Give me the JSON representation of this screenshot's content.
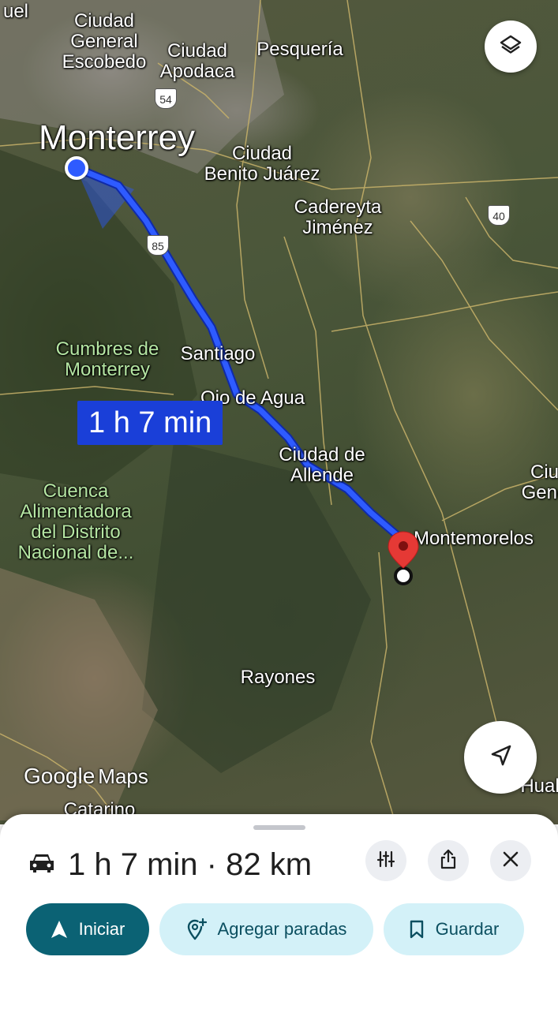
{
  "map": {
    "place_labels": [
      {
        "id": "uel",
        "text": "uel",
        "green": false,
        "big": false
      },
      {
        "id": "escobedo",
        "text": "Ciudad\nGeneral\nEscobedo",
        "green": false,
        "big": false
      },
      {
        "id": "apodaca",
        "text": "Ciudad\nApodaca",
        "green": false,
        "big": false
      },
      {
        "id": "pesqueria",
        "text": "Pesquería",
        "green": false,
        "big": false
      },
      {
        "id": "monterrey",
        "text": "Monterrey",
        "green": false,
        "big": true
      },
      {
        "id": "benito",
        "text": "Ciudad\nBenito Juárez",
        "green": false,
        "big": false
      },
      {
        "id": "cadereyta",
        "text": "Cadereyta\nJiménez",
        "green": false,
        "big": false
      },
      {
        "id": "cumbres",
        "text": "Cumbres de\nMonterrey",
        "green": true,
        "big": false
      },
      {
        "id": "santiago",
        "text": "Santiago",
        "green": false,
        "big": false
      },
      {
        "id": "ojo",
        "text": "Ojo de Agua",
        "green": false,
        "big": false
      },
      {
        "id": "allende",
        "text": "Ciudad de\nAllende",
        "green": false,
        "big": false
      },
      {
        "id": "cuenca",
        "text": "Cuenca\nAlimentadora\ndel Distrito\nNacional de...",
        "green": true,
        "big": false
      },
      {
        "id": "montemorelos",
        "text": "Montemorelos",
        "green": false,
        "big": false
      },
      {
        "id": "ciu_gene",
        "text": "Ciu\nGene",
        "green": false,
        "big": false
      },
      {
        "id": "rayones",
        "text": "Rayones",
        "green": false,
        "big": false
      },
      {
        "id": "hual",
        "text": "Hual",
        "green": false,
        "big": false
      },
      {
        "id": "catarino",
        "text": "Catarino",
        "green": false,
        "big": false
      }
    ],
    "highway_shields": [
      "54",
      "85",
      "40"
    ],
    "eta_label": "1 h 7 min",
    "attribution": {
      "google": "Google",
      "maps": "Maps"
    },
    "route_color": "#1a3fd8",
    "destination_pin_color": "#e53935"
  },
  "controls": {
    "layers_icon": "layers-icon",
    "recenter_icon": "navigation-arrow-icon"
  },
  "sheet": {
    "mode_icon": "car-icon",
    "summary_duration": "1 h 7 min",
    "summary_separator": "·",
    "summary_distance": "82 km",
    "options_icon": "tune-icon",
    "share_icon": "share-icon",
    "close_icon": "close-icon",
    "start_label": "Iniciar",
    "add_stops_label": "Agregar paradas",
    "save_label": "Guardar",
    "accent_color": "#0b6274",
    "secondary_color": "#d3f1f8"
  }
}
